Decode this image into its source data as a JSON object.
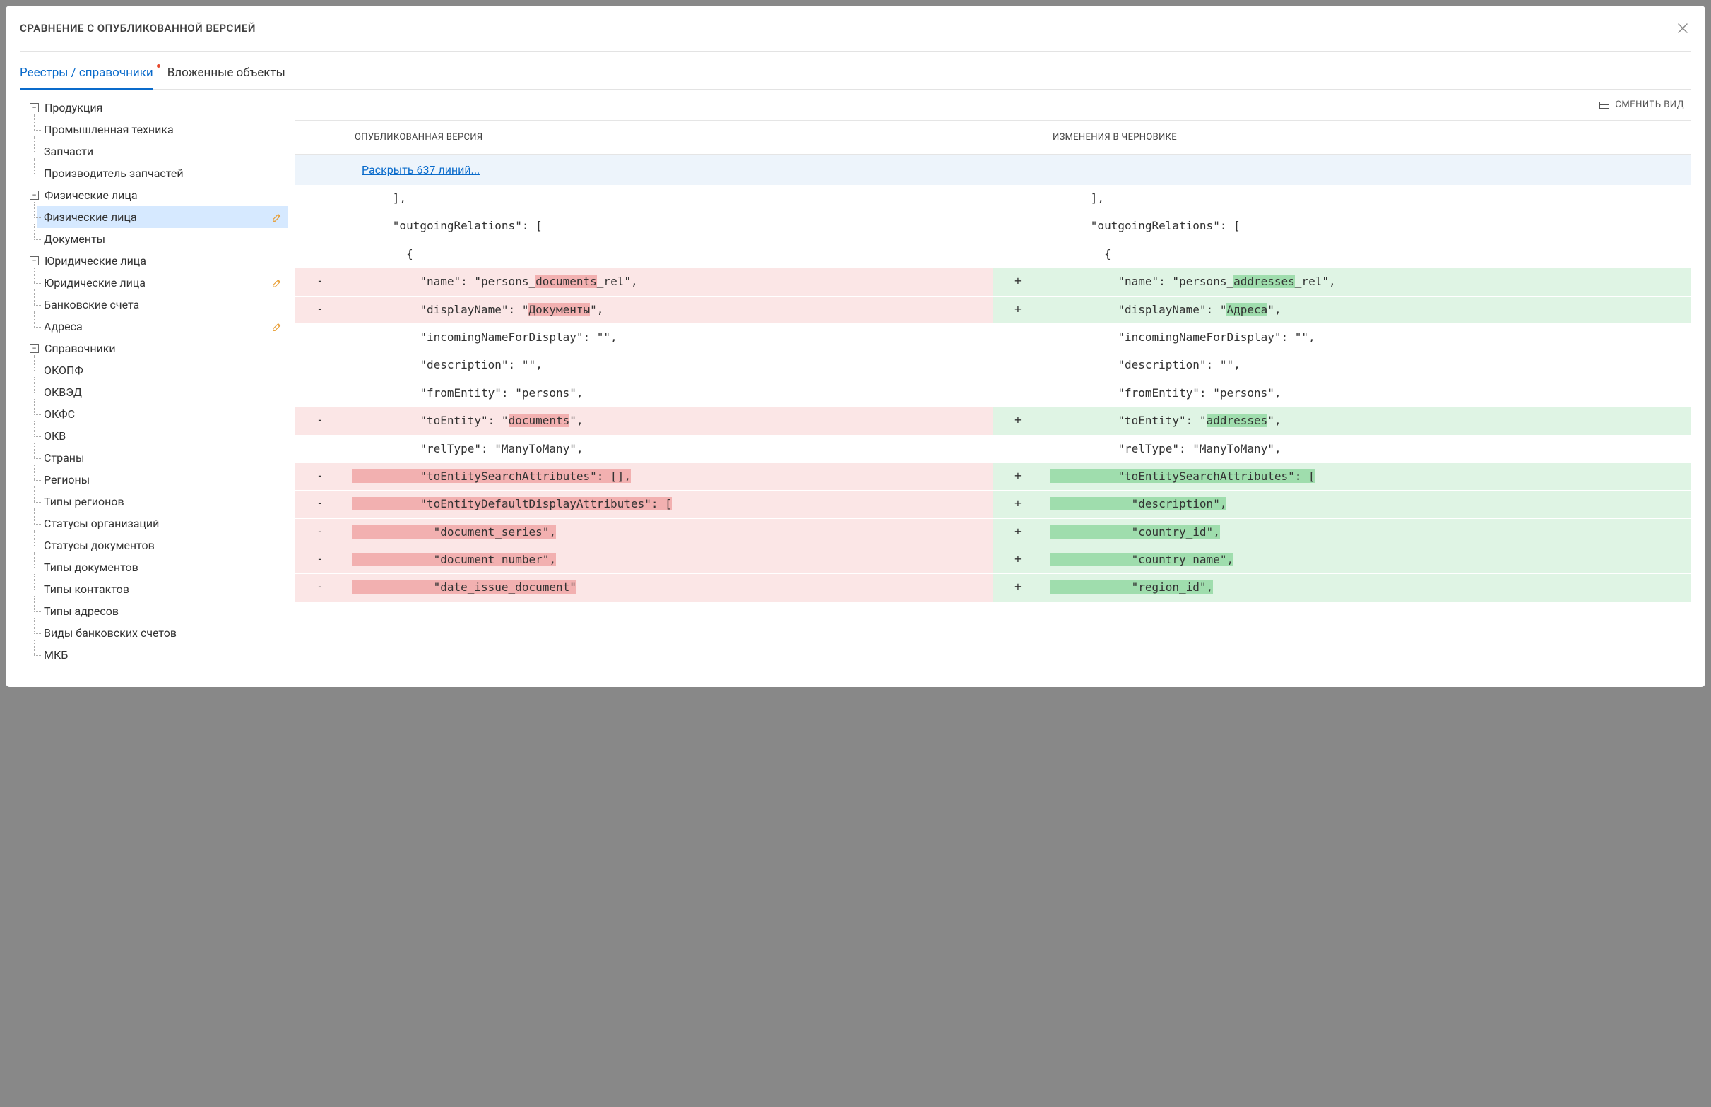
{
  "modal": {
    "title": "СРАВНЕНИЕ С ОПУБЛИКОВАННОЙ ВЕРСИЕЙ"
  },
  "tabs": {
    "registries": "Реестры / справочники",
    "nested": "Вложенные объекты"
  },
  "tree": {
    "products": "Продукция",
    "products_children": [
      "Промышленная техника",
      "Запчасти",
      "Производитель запчастей"
    ],
    "persons": "Физические лица",
    "persons_children": [
      "Физические лица",
      "Документы"
    ],
    "legal": "Юридические лица",
    "legal_children": [
      "Юридические лица",
      "Банковские счета",
      "Адреса"
    ],
    "refs": "Справочники",
    "refs_children": [
      "ОКОПФ",
      "ОКВЭД",
      "ОКФС",
      "ОКВ",
      "Страны",
      "Регионы",
      "Типы регионов",
      "Статусы организаций",
      "Статусы документов",
      "Типы документов",
      "Типы контактов",
      "Типы адресов",
      "Виды банковских счетов",
      "МКБ"
    ]
  },
  "toolbar": {
    "change_view": "СМЕНИТЬ ВИД"
  },
  "diff": {
    "col_published": "ОПУБЛИКОВАННАЯ ВЕРСИЯ",
    "col_draft": "ИЗМЕНЕНИЯ В ЧЕРНОВИКЕ",
    "expand": "Раскрыть 637 линий...",
    "rows": {
      "r0l": "      ],",
      "r0r": "      ],",
      "r1l": "      \"outgoingRelations\": [",
      "r1r": "      \"outgoingRelations\": [",
      "r2l": "        {",
      "r2r": "        {",
      "r3l_pre": "          \"name\": \"persons_",
      "r3l_hi": "documents",
      "r3l_post": "_rel\",",
      "r3r_pre": "          \"name\": \"persons_",
      "r3r_hi": "addresses",
      "r3r_post": "_rel\",",
      "r4l_pre": "          \"displayName\": \"",
      "r4l_hi": "Документы",
      "r4l_post": "\",",
      "r4r_pre": "          \"displayName\": \"",
      "r4r_hi": "Адреса",
      "r4r_post": "\",",
      "r5l": "          \"incomingNameForDisplay\": \"\",",
      "r5r": "          \"incomingNameForDisplay\": \"\",",
      "r6l": "          \"description\": \"\",",
      "r6r": "          \"description\": \"\",",
      "r7l": "          \"fromEntity\": \"persons\",",
      "r7r": "          \"fromEntity\": \"persons\",",
      "r8l_pre": "          \"toEntity\": \"",
      "r8l_hi": "documents",
      "r8l_post": "\",",
      "r8r_pre": "          \"toEntity\": \"",
      "r8r_hi": "addresses",
      "r8r_post": "\",",
      "r9l": "          \"relType\": \"ManyToMany\",",
      "r9r": "          \"relType\": \"ManyToMany\",",
      "r10l": "          \"toEntitySearchAttributes\": [],",
      "r10r": "          \"toEntitySearchAttributes\": [",
      "r11l": "          \"toEntityDefaultDisplayAttributes\": [",
      "r11r": "            \"description\",",
      "r12l": "            \"document_series\",",
      "r12r": "            \"country_id\",",
      "r13l": "            \"document_number\",",
      "r13r": "            \"country_name\",",
      "r14l": "            \"date_issue_document\"",
      "r14r": "            \"region_id\","
    }
  }
}
